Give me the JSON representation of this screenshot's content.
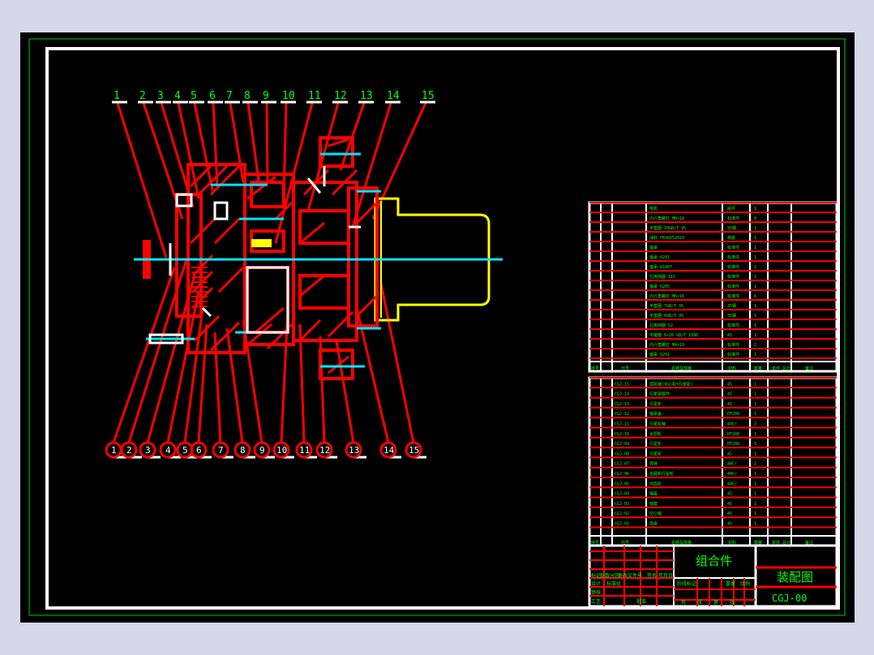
{
  "colors": {
    "page_bg": "#d6d8ea",
    "sheet_bg": "#000000",
    "border_outer": "#00cc00",
    "border_inner": "#ffffff",
    "part_red": "#ff0000",
    "axis_cyan": "#00e5ff",
    "motor_yellow": "#ffff00",
    "label_green": "#00ff00"
  },
  "drawing": {
    "top_labels": [
      "1",
      "2",
      "3",
      "4",
      "5",
      "6",
      "7",
      "8",
      "9",
      "10",
      "11",
      "12",
      "13",
      "14",
      "15"
    ],
    "bottom_labels": [
      "1",
      "2",
      "3",
      "4",
      "5",
      "6",
      "7",
      "8",
      "9",
      "10",
      "11",
      "12",
      "13",
      "14",
      "15"
    ]
  },
  "upper_table": {
    "rows": [
      {
        "name": "电机",
        "material": "组件",
        "qty": "1"
      },
      {
        "name": "内六角螺钉 M6×16",
        "material": "标准件",
        "qty": "8"
      },
      {
        "name": "平垫圈 10GB/T 95",
        "material": "35钢",
        "qty": "1"
      },
      {
        "name": "油封 FB30X52X10",
        "material": "橡胶",
        "qty": "1"
      },
      {
        "name": "轴承",
        "material": "标准件",
        "qty": "1"
      },
      {
        "name": "轴承 6201",
        "material": "标准件",
        "qty": "1"
      },
      {
        "name": "轴承 61807",
        "material": "标准件",
        "qty": "2"
      },
      {
        "name": "孔用挡圈 115",
        "material": "标准件",
        "qty": "1"
      },
      {
        "name": "轴承 6205",
        "material": "标准件",
        "qty": "1"
      },
      {
        "name": "内六角螺钉 M6×16",
        "material": "标准件",
        "qty": "6"
      },
      {
        "name": "平垫圈 7GB/T 95",
        "material": "35钢",
        "qty": "1"
      },
      {
        "name": "平垫圈 6GB/T 95",
        "material": "35钢",
        "qty": "1"
      },
      {
        "name": "孔用挡圈 52",
        "material": "标准件",
        "qty": "1"
      },
      {
        "name": "平键键 6×20 GB/T 1096",
        "material": "45",
        "qty": "1"
      },
      {
        "name": "内六角螺钉 M4×10",
        "material": "标准件",
        "qty": "2"
      },
      {
        "name": "轴承 6201",
        "material": "标准件",
        "qty": "1"
      }
    ],
    "header": {
      "no": "序号",
      "code": "代号",
      "name": "名称及规格",
      "material": "材料",
      "qty": "数量",
      "weight": "单件 总计",
      "remark": "备注"
    }
  },
  "lower_table": {
    "rows": [
      {
        "code": "CGJ-15",
        "name": "齿轮轴(中心轮+行星轮)",
        "material": "45",
        "qty": "1"
      },
      {
        "code": "CGJ-14",
        "name": "行星架组件",
        "material": "45",
        "qty": "1"
      },
      {
        "code": "CGJ-13",
        "name": "行星轮",
        "material": "45",
        "qty": "1"
      },
      {
        "code": "CGJ-12",
        "name": "轴承盖",
        "material": "HT200",
        "qty": "1"
      },
      {
        "code": "CGJ-11",
        "name": "行星轮轴",
        "material": "40Cr",
        "qty": "3"
      },
      {
        "code": "CGJ-10",
        "name": "太阳轮",
        "material": "HT200",
        "qty": "1"
      },
      {
        "code": "CGJ-09",
        "name": "行星轮",
        "material": "HT200",
        "qty": "3"
      },
      {
        "code": "CGJ-08",
        "name": "行星轮",
        "material": "45",
        "qty": "1"
      },
      {
        "code": "CGJ-07",
        "name": "壳体",
        "material": "40Cr",
        "qty": "1"
      },
      {
        "code": "CGJ-06",
        "name": "齿圈和行星轮",
        "material": "40Cr",
        "qty": "1"
      },
      {
        "code": "CGJ-05",
        "name": "内齿轮",
        "material": "40Cr",
        "qty": "1"
      },
      {
        "code": "CGJ-04",
        "name": "端盖",
        "material": "45",
        "qty": "1"
      },
      {
        "code": "CGJ-03",
        "name": "轴套",
        "material": "45",
        "qty": "1"
      },
      {
        "code": "CGJ-02",
        "name": "空心轴",
        "material": "45",
        "qty": "1"
      },
      {
        "code": "CGJ-01",
        "name": "底座",
        "material": "45",
        "qty": "1"
      }
    ],
    "header": {
      "no": "序号",
      "code": "代号",
      "name": "名称及规格",
      "material": "材料",
      "qty": "数量",
      "weight": "单件 总计",
      "remark": "备注"
    }
  },
  "title_block": {
    "assembly": "组合件",
    "drawing_name": "装配图",
    "drawing_no": "CGJ-00",
    "labels": [
      "标记",
      "处数",
      "分区",
      "更改文件号",
      "签名",
      "年月日",
      "设计",
      "标准化",
      "阶段标记",
      "重量",
      "比例",
      "审核",
      "工艺",
      "批准",
      "共",
      "张",
      "第",
      "张"
    ]
  }
}
